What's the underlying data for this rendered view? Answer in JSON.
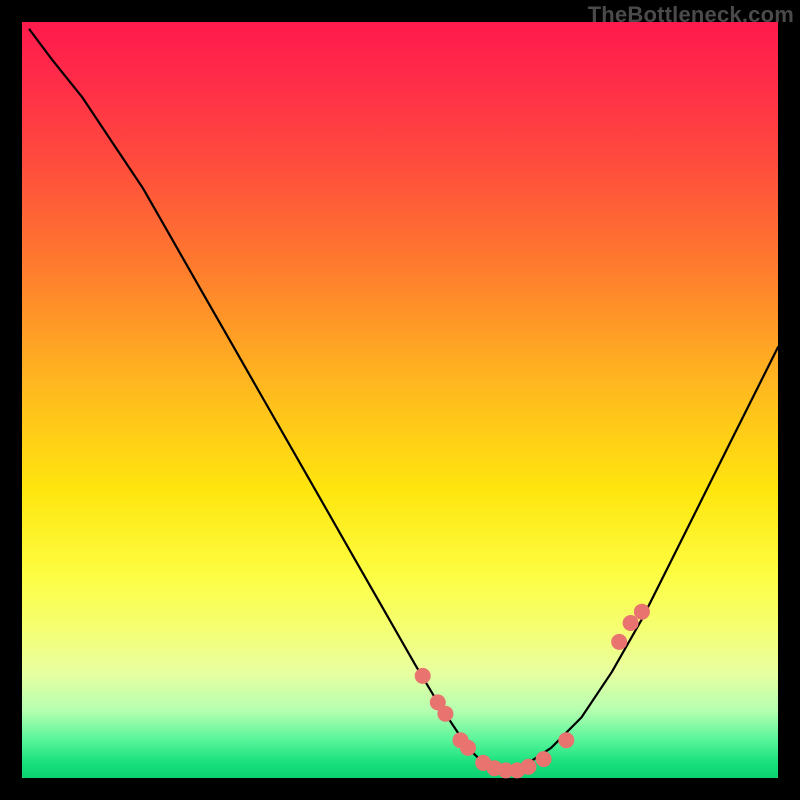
{
  "watermark": "TheBottleneck.com",
  "chart_data": {
    "type": "line",
    "title": "",
    "xlabel": "",
    "ylabel": "",
    "xlim": [
      0,
      100
    ],
    "ylim": [
      0,
      100
    ],
    "gradient_stops": [
      {
        "pos": 0,
        "color": "#ff1a4d"
      },
      {
        "pos": 18,
        "color": "#ff4a3e"
      },
      {
        "pos": 48,
        "color": "#ffb81f"
      },
      {
        "pos": 73,
        "color": "#fdfd42"
      },
      {
        "pos": 95,
        "color": "#57f59a"
      },
      {
        "pos": 100,
        "color": "#0ccf72"
      }
    ],
    "series": [
      {
        "name": "bottleneck-curve",
        "x": [
          1,
          4,
          8,
          12,
          16,
          20,
          24,
          28,
          32,
          36,
          40,
          44,
          48,
          52,
          55,
          57,
          59,
          61,
          63,
          65,
          67,
          70,
          74,
          78,
          82,
          86,
          90,
          94,
          98,
          100
        ],
        "y": [
          99,
          95,
          90,
          84,
          78,
          71,
          64,
          57,
          50,
          43,
          36,
          29,
          22,
          15,
          10,
          7,
          4,
          2,
          1,
          1,
          2,
          4,
          8,
          14,
          21,
          29,
          37,
          45,
          53,
          57
        ]
      }
    ],
    "markers": {
      "name": "highlight-dots",
      "color": "#e9736f",
      "radius_px": 8,
      "x": [
        53,
        55,
        56,
        58,
        59,
        61,
        62.5,
        64,
        65.5,
        67,
        69,
        72,
        79,
        80.5,
        82
      ],
      "y": [
        13.5,
        10,
        8.5,
        5,
        4,
        2,
        1.3,
        1,
        1,
        1.5,
        2.5,
        5,
        18,
        20.5,
        22
      ]
    }
  }
}
